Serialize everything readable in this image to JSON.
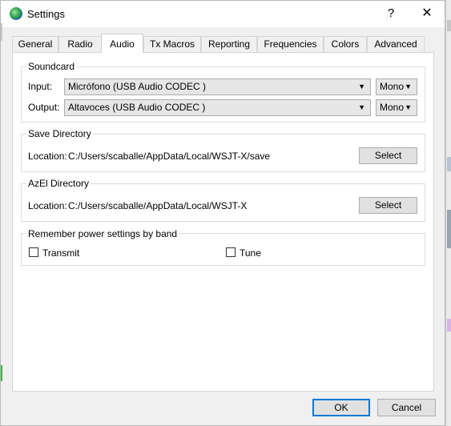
{
  "window": {
    "title": "Settings",
    "help_glyph": "?",
    "close_glyph": "✕"
  },
  "tabs": [
    {
      "label": "General"
    },
    {
      "label": "Radio"
    },
    {
      "label": "Audio"
    },
    {
      "label": "Tx Macros"
    },
    {
      "label": "Reporting"
    },
    {
      "label": "Frequencies"
    },
    {
      "label": "Colors"
    },
    {
      "label": "Advanced"
    }
  ],
  "active_tab": "Audio",
  "soundcard": {
    "title": "Soundcard",
    "input_label": "Input:",
    "input_value": "Micrófono (USB Audio CODEC )",
    "input_channel": "Mono",
    "output_label": "Output:",
    "output_value": "Altavoces (USB Audio CODEC )",
    "output_channel": "Mono"
  },
  "save_directory": {
    "title": "Save Directory",
    "location_label": "Location:",
    "path": "C:/Users/scaballe/AppData/Local/WSJT-X/save",
    "select_label": "Select"
  },
  "azel_directory": {
    "title": "AzEl Directory",
    "location_label": "Location:",
    "path": "C:/Users/scaballe/AppData/Local/WSJT-X",
    "select_label": "Select"
  },
  "power_settings": {
    "title": "Remember power settings by band",
    "transmit_label": "Transmit",
    "tune_label": "Tune",
    "transmit_checked": false,
    "tune_checked": false
  },
  "footer": {
    "ok_label": "OK",
    "cancel_label": "Cancel"
  },
  "icons": {
    "dropdown": "▼"
  },
  "colors": {
    "accent": "#0078d7",
    "panel": "#ffffff",
    "window": "#f0f0f0"
  }
}
